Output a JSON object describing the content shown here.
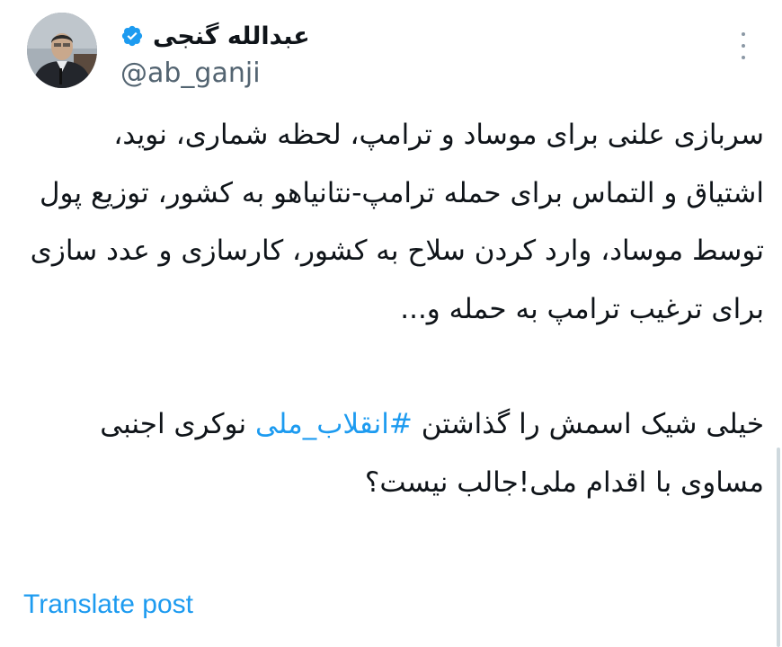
{
  "author": {
    "display_name": "عبدالله گنجی",
    "handle": "@ab_ganji",
    "verified": true,
    "avatar_icon": "profile-photo"
  },
  "post": {
    "paragraph1": "سربازی علنی برای موساد و ترامپ، لحظه شماری، نوید، اشتیاق و التماس برای حمله ترامپ-نتانیاهو به کشور، توزیع پول توسط موساد، وارد کردن سلاح به کشور، کارسازی و عدد سازی برای ترغیب ترامپ به حمله و...",
    "paragraph2_before_hashtag": "خیلی شیک اسمش را گذاشتن",
    "hashtag": "#انقلاب_ملی",
    "paragraph2_after_hashtag": "نوکری اجنبی مساوی با اقدام ملی!جالب نیست؟"
  },
  "actions": {
    "translate_label": "Translate post",
    "more_icon": "more-vertical-icon"
  },
  "colors": {
    "link": "#1d9bf0",
    "text": "#0f1419",
    "secondary": "#536471",
    "verified": "#1d9bf0"
  }
}
